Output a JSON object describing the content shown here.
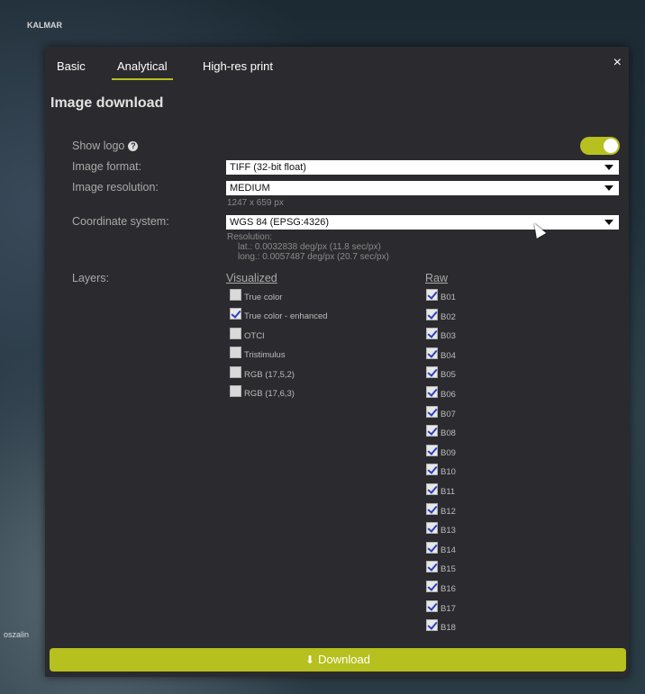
{
  "map": {
    "label_top": "KALMAR",
    "label_bottom": "oszalin"
  },
  "tabs": [
    {
      "label": "Basic"
    },
    {
      "label": "Analytical"
    },
    {
      "label": "High-res print"
    }
  ],
  "active_tab": "Analytical",
  "close_glyph": "×",
  "heading": "Image download",
  "show_logo": {
    "label": "Show logo",
    "enabled": true,
    "help_glyph": "?"
  },
  "image_format": {
    "label": "Image format:",
    "value": "TIFF (32-bit float)"
  },
  "image_resolution": {
    "label": "Image resolution:",
    "value": "MEDIUM",
    "size": "1247 x 659 px"
  },
  "coordinate_system": {
    "label": "Coordinate system:",
    "value": "WGS 84 (EPSG:4326)",
    "resolution_title": "Resolution:",
    "lat": "lat.: 0.0032838 deg/px (11.8 sec/px)",
    "long": "long.: 0.0057487 deg/px (20.7 sec/px)"
  },
  "layers": {
    "label": "Layers:",
    "visualized_header": "Visualized",
    "raw_header": "Raw",
    "visualized": [
      {
        "label": "True color",
        "checked": false
      },
      {
        "label": "True color - enhanced",
        "checked": true
      },
      {
        "label": "OTCI",
        "checked": false
      },
      {
        "label": "Tristimulus",
        "checked": false
      },
      {
        "label": "RGB (17,5,2)",
        "checked": false
      },
      {
        "label": "RGB (17,6,3)",
        "checked": false
      }
    ],
    "raw": [
      {
        "label": "B01",
        "checked": true
      },
      {
        "label": "B02",
        "checked": true
      },
      {
        "label": "B03",
        "checked": true
      },
      {
        "label": "B04",
        "checked": true
      },
      {
        "label": "B05",
        "checked": true
      },
      {
        "label": "B06",
        "checked": true
      },
      {
        "label": "B07",
        "checked": true
      },
      {
        "label": "B08",
        "checked": true
      },
      {
        "label": "B09",
        "checked": true
      },
      {
        "label": "B10",
        "checked": true
      },
      {
        "label": "B11",
        "checked": true
      },
      {
        "label": "B12",
        "checked": true
      },
      {
        "label": "B13",
        "checked": true
      },
      {
        "label": "B14",
        "checked": true
      },
      {
        "label": "B15",
        "checked": true
      },
      {
        "label": "B16",
        "checked": true
      },
      {
        "label": "B17",
        "checked": true
      },
      {
        "label": "B18",
        "checked": true
      }
    ]
  },
  "download_label": "Download",
  "colors": {
    "accent": "#b6c01e",
    "panel": "#2b2b2f"
  }
}
